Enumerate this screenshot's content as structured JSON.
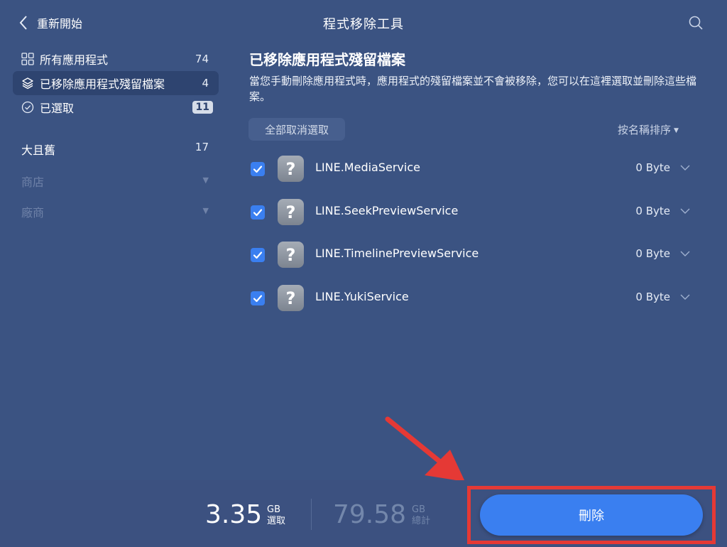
{
  "header": {
    "back_label": "重新開始",
    "title": "程式移除工具"
  },
  "sidebar": {
    "items": [
      {
        "label": "所有應用程式",
        "count": "74",
        "icon": "grid-icon"
      },
      {
        "label": "已移除應用程式殘留檔案",
        "count": "4",
        "icon": "layers-icon"
      },
      {
        "label": "已選取",
        "count": "11",
        "icon": "check-circle-icon"
      }
    ],
    "groups": [
      {
        "label": "大且舊",
        "count": "17"
      },
      {
        "label": "商店"
      },
      {
        "label": "廠商"
      }
    ]
  },
  "main": {
    "heading": "已移除應用程式殘留檔案",
    "description": "當您手動刪除應用程式時，應用程式的殘留檔案並不會被移除，您可以在這裡選取並刪除這些檔案。",
    "deselect_all_label": "全部取消選取",
    "sort_label": "按名稱排序",
    "files": [
      {
        "name": "LINE.MediaService",
        "size": "0 Byte",
        "checked": true
      },
      {
        "name": "LINE.SeekPreviewService",
        "size": "0 Byte",
        "checked": true
      },
      {
        "name": "LINE.TimelinePreviewService",
        "size": "0 Byte",
        "checked": true
      },
      {
        "name": "LINE.YukiService",
        "size": "0 Byte",
        "checked": true
      }
    ],
    "file_icon_glyph": "?"
  },
  "footer": {
    "selected_value": "3.35",
    "selected_unit": "GB",
    "selected_label": "選取",
    "total_value": "79.58",
    "total_unit": "GB",
    "total_label": "總計",
    "delete_label": "刪除"
  },
  "colors": {
    "background": "#3b5382",
    "accent": "#3a7ff0",
    "annotation": "#e53935"
  }
}
